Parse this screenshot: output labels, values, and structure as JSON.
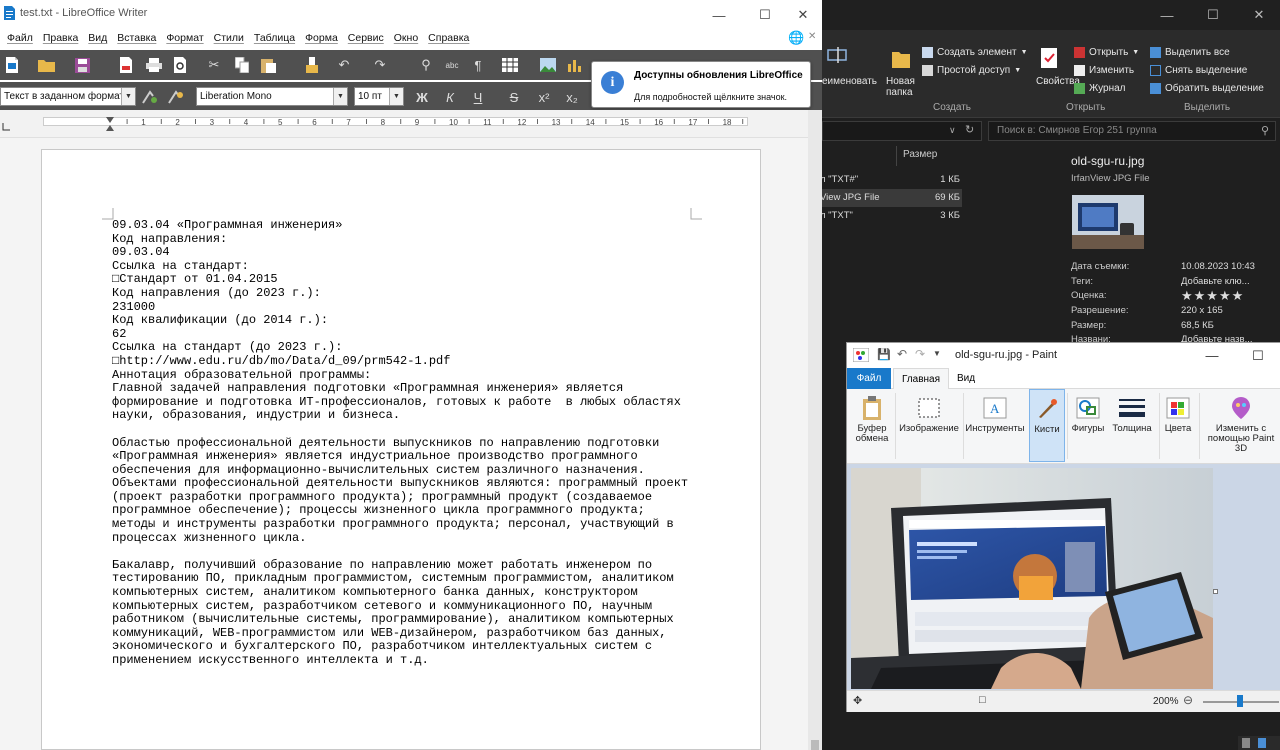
{
  "writer": {
    "title": "test.txt - LibreOffice Writer",
    "menu": [
      "Файл",
      "Правка",
      "Вид",
      "Вставка",
      "Формат",
      "Стили",
      "Таблица",
      "Форма",
      "Сервис",
      "Окно",
      "Справка"
    ],
    "paragraph_style": "Текст в заданном формате",
    "font_name": "Liberation Mono",
    "font_size": "10 пт",
    "format_buttons": [
      "Ж",
      "К",
      "Ч",
      "S",
      "x²",
      "x₂"
    ],
    "ruler_numbers": [
      "1",
      "2",
      "3",
      "4",
      "5",
      "6",
      "7",
      "8",
      "9",
      "10",
      "11",
      "12",
      "13",
      "14",
      "15",
      "16",
      "17",
      "18"
    ],
    "notification": {
      "title": "Доступны обновления LibreOffice",
      "text": "Для подробностей щёлкните значок."
    },
    "document_lines": [
      "09.03.04 «Программная инженерия»",
      "Код направления:",
      "09.03.04",
      "Ссылка на стандарт:",
      "□Стандарт от 01.04.2015",
      "Код направления (до 2023 г.):",
      "231000",
      "Код квалификации (до 2014 г.):",
      "62",
      "Ссылка на стандарт (до 2023 г.):",
      "□http://www.edu.ru/db/mo/Data/d_09/prm542-1.pdf",
      "Аннотация образовательной программы:",
      "Главной задачей направления подготовки «Программная инженерия» является",
      "формирование и подготовка ИТ-профессионалов, готовых к работе  в любых областях",
      "науки, образования, индустрии и бизнеса.",
      "",
      "Областью профессиональной деятельности выпускников по направлению подготовки",
      "«Программная инженерия» является индустриальное производство программного",
      "обеспечения для информационно-вычислительных систем различного назначения.",
      "Объектами профессиональной деятельности выпускников являются: программный проект",
      "(проект разработки программного продукта); программный продукт (создаваемое",
      "программное обеспечение); процессы жизненного цикла программного продукта;",
      "методы и инструменты разработки программного продукта; персонал, участвующий в",
      "процессах жизненного цикла.",
      "",
      "Бакалавр, получивший образование по направлению может работать инженером по",
      "тестированию ПО, прикладным программистом, системным программистом, аналитиком",
      "компьютерных систем, аналитиком компьютерного банка данных, конструктором",
      "компьютерных систем, разработчиком сетевого и коммуникационного ПО, научным",
      "работником (вычислительные системы, программирование), аналитиком компьютерных",
      "коммуникаций, WEB-программистом или WEB-дизайнером, разработчиком баз данных,",
      "экономического и бухгалтерского ПО, разработчиком интеллектуальных систем с",
      "применением искусственного интеллекта и т.д."
    ]
  },
  "explorer": {
    "ribbon": {
      "rename": "еименовать",
      "new_folder": "Новая папка",
      "new_item": "Создать элемент",
      "easy_access": "Простой доступ",
      "properties": "Свойства",
      "open": "Открыть",
      "edit": "Изменить",
      "history": "Журнал",
      "select_all": "Выделить все",
      "select_none": "Снять выделение",
      "invert_selection": "Обратить выделение",
      "group_create": "Создать",
      "group_open": "Открыть",
      "group_select": "Выделить"
    },
    "search_placeholder": "Поиск в: Смирнов Егор 251 группа",
    "column_size": "Размер",
    "files": [
      {
        "type": "л \"TXT#\"",
        "size": "1 КБ"
      },
      {
        "type": "View JPG File",
        "size": "69 КБ"
      },
      {
        "type": "л \"TXT\"",
        "size": "3 КБ"
      }
    ],
    "preview": {
      "name": "old-sgu-ru.jpg",
      "kind": "IrfanView JPG File",
      "props": [
        {
          "label": "Дата съемки:",
          "value": "10.08.2023 10:43"
        },
        {
          "label": "Теги:",
          "value": "Добавьте клю..."
        },
        {
          "label": "Оценка:",
          "value": "★★★★★"
        },
        {
          "label": "Разрешение:",
          "value": "220 x 165"
        },
        {
          "label": "Размер:",
          "value": "68,5 КБ"
        },
        {
          "label": "Названи:",
          "value": "Добавьте назв..."
        }
      ]
    }
  },
  "paint": {
    "title": "old-sgu-ru.jpg - Paint",
    "tabs": [
      "Файл",
      "Главная",
      "Вид"
    ],
    "groups": [
      "Буфер обмена",
      "Изображение",
      "Инструменты",
      "Кисти",
      "Фигуры",
      "Толщина",
      "Цвета",
      "Изменить с помощью Paint 3D"
    ],
    "zoom": "200%"
  },
  "colors": {
    "accent_blue": "#1979ca",
    "toolbar_dark": "#505050",
    "explorer_bg": "#1f1f1f"
  }
}
